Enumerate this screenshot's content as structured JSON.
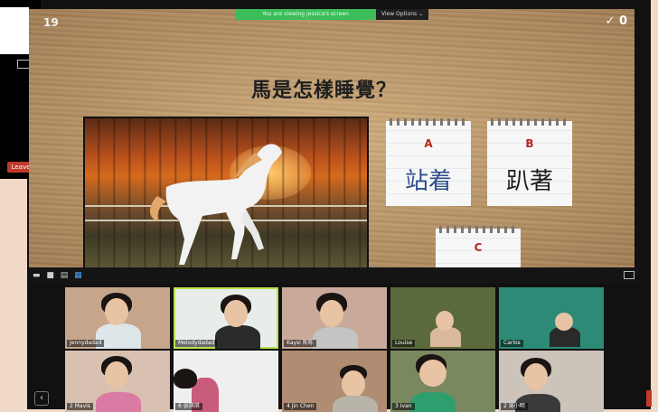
{
  "screen_share": {
    "notice": "You are viewing jessica's screen",
    "view_options_label": "View Options ⌄"
  },
  "side_panel": {
    "leave_label": "Leave"
  },
  "slide": {
    "number": "19",
    "check_count": "✓ 0",
    "question": "馬是怎樣睡覺？",
    "options": [
      {
        "letter": "A",
        "text": "站着",
        "color": "#2f4e8c"
      },
      {
        "letter": "B",
        "text": "趴著",
        "color": "#1c1c1c"
      },
      {
        "letter": "C",
        "text": "",
        "color": "#1c1c1c"
      }
    ],
    "letter_color": "#b5261d"
  },
  "participants": [
    {
      "name": "Jennydadad",
      "bg": "#c6a58a",
      "shirt": "#dfe6ea"
    },
    {
      "name": "Melodydadad",
      "bg": "#e9edea",
      "shirt": "#2a2a2a"
    },
    {
      "name": "Kaysi 陈陈",
      "bg": "#c9aa9a",
      "shirt": "#c4c4c4"
    },
    {
      "name": "Louise",
      "bg": "#5b6a3d",
      "shirt": "#d9b89c"
    },
    {
      "name": "Carlos",
      "bg": "#2c8a76",
      "shirt": "#2a2a2a"
    },
    {
      "name": "2 Mavis",
      "bg": "#d8c1b0",
      "shirt": "#d97ba2"
    },
    {
      "name": "6 张琪琪",
      "bg": "#efeff0",
      "shirt": "#c85c7a"
    },
    {
      "name": "4 Jin Chen",
      "bg": "#b08c72",
      "shirt": "#b9b4aa"
    },
    {
      "name": "3 Ivan",
      "bg": "#7a8860",
      "shirt": "#2f9e6f"
    },
    {
      "name": "2 吳小明",
      "bg": "#ccc3bb",
      "shirt": "#3a3a3a"
    }
  ]
}
